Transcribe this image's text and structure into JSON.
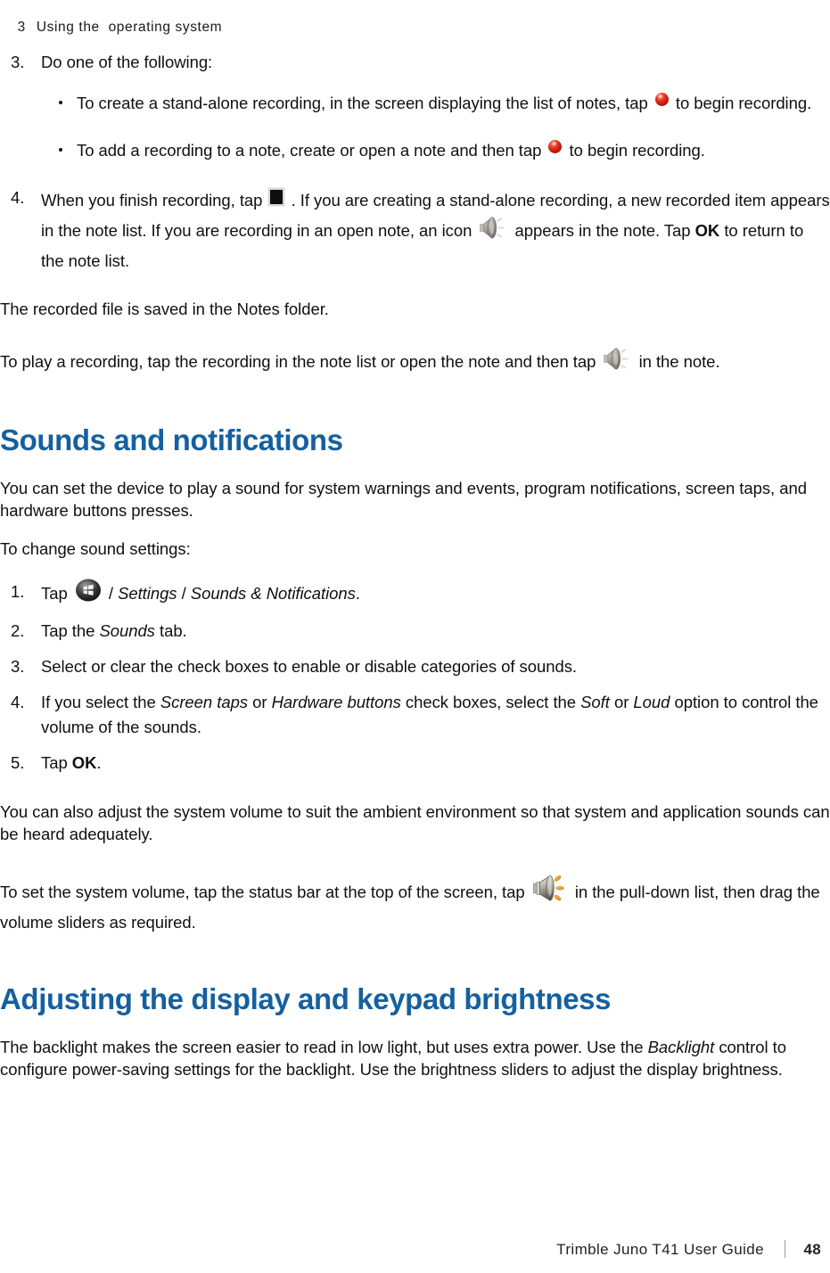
{
  "header": {
    "chapter_number": "3",
    "chapter_title": "Using the  operating system"
  },
  "steps_recording": {
    "step3": {
      "marker": "3.",
      "text": "Do one of the following:",
      "bullets": [
        {
          "icon": "record-icon",
          "before": "To create a stand-alone recording, in the screen displaying the list of notes, tap",
          "after": "to begin recording."
        },
        {
          "icon": "record-icon",
          "before": "To add a recording to a note, create or open a note and then tap",
          "after": "to begin recording."
        }
      ]
    },
    "step4": {
      "marker": "4.",
      "part1": "When you finish recording, tap",
      "stop_icon": "stop-icon",
      "part2": ". If you are creating a stand-alone recording, a new recorded item appears in the note list. If you are recording in an open note, an icon",
      "speaker_icon": "speaker-gray-icon",
      "part3": "appears in the note. Tap",
      "ok_label": "OK",
      "part4": "to return to the note list."
    }
  },
  "paragraphs": {
    "saved_note": "The recorded file is saved in the Notes folder.",
    "play_recording_before": "To play a recording, tap the recording in the note list or open the note and then tap",
    "play_recording_after": "in the note."
  },
  "sounds_section": {
    "heading": "Sounds and notifications",
    "intro": "You can set the device to play a sound for system warnings and events, program notifications, screen taps, and hardware buttons presses.",
    "lead_in": "To change sound settings:",
    "steps": [
      {
        "marker": "1.",
        "pre": "Tap",
        "icon": "windows-start-icon",
        "path_slash1": "/",
        "path_item1": "Settings",
        "path_slash2": "/",
        "path_item2": "Sounds & Notifications",
        "post": "."
      },
      {
        "marker": "2.",
        "pre": "Tap the",
        "em1": "Sounds",
        "post": "tab."
      },
      {
        "marker": "3.",
        "text": "Select or clear the check boxes to enable or disable categories of sounds."
      },
      {
        "marker": "4.",
        "pre": "If you select the",
        "em1": "Screen taps",
        "mid1": "or",
        "em2": "Hardware buttons",
        "mid2": "check boxes, select the",
        "em3": "Soft",
        "mid3": "or",
        "em4": "Loud",
        "post": "option to control the volume of the sounds."
      },
      {
        "marker": "5.",
        "pre": "Tap",
        "bold1": "OK",
        "post": "."
      }
    ],
    "volume_note": "You can also adjust the system volume to suit the ambient environment so that system and application sounds can be heard adequately.",
    "set_volume_before": "To set the system volume, tap the status bar at the top of the screen, tap",
    "set_volume_icon": "speaker-orange-icon",
    "set_volume_after": "in the pull-down list, then drag the volume sliders as required."
  },
  "brightness_section": {
    "heading": "Adjusting the display and keypad brightness",
    "body_pre": "The backlight makes the screen easier to read in low light, but uses extra power. Use the",
    "body_em": "Backlight",
    "body_post": "control to configure power-saving settings for the backlight. Use the brightness sliders to adjust the display brightness."
  },
  "footer": {
    "guide_name": "Trimble Juno T41 User Guide",
    "page_number": "48"
  },
  "colors": {
    "heading_blue": "#15609F",
    "record_red": "#C4241A",
    "wave_orange": "#F0A030",
    "body_text": "#101010"
  }
}
